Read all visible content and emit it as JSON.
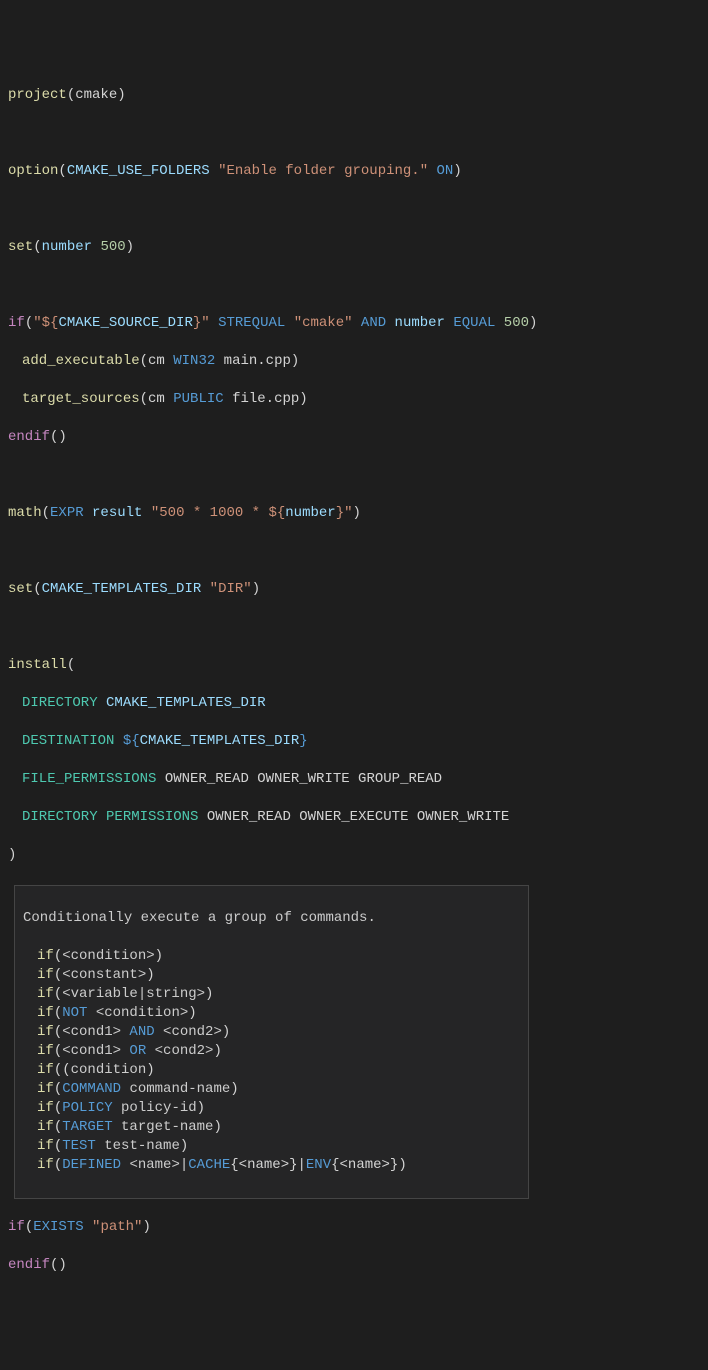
{
  "code": {
    "l1": {
      "fn": "project",
      "arg": "cmake"
    },
    "l2": {
      "fn": "option",
      "var": "CMAKE_USE_FOLDERS",
      "str": "\"Enable folder grouping.\"",
      "val": "ON"
    },
    "l3": {
      "fn": "set",
      "var": "number",
      "num": "500"
    },
    "l4": {
      "kw": "if",
      "str1": "\"${",
      "var1": "CMAKE_SOURCE_DIR",
      "str1b": "}\"",
      "op1": "STREQUAL",
      "str2": "\"cmake\"",
      "and": "AND",
      "var2": "number",
      "op2": "EQUAL",
      "num": "500"
    },
    "l5": {
      "fn": "add_executable",
      "args1": "cm",
      "kw": "WIN32",
      "args2": "main.cpp"
    },
    "l6": {
      "fn": "target_sources",
      "args1": "cm",
      "kw": "PUBLIC",
      "args2": "file.cpp"
    },
    "l7": {
      "kw": "endif"
    },
    "l8": {
      "fn": "math",
      "kw": "EXPR",
      "var": "result",
      "str": "\"500 * 1000 * ${",
      "innerVar": "number",
      "strEnd": "}\""
    },
    "l9": {
      "fn": "set",
      "var": "CMAKE_TEMPLATES_DIR",
      "str": "\"DIR\""
    },
    "l10": {
      "fn": "install"
    },
    "l11": {
      "kw": "DIRECTORY",
      "var": "CMAKE_TEMPLATES_DIR"
    },
    "l12": {
      "kw": "DESTINATION",
      "pre": "${",
      "var": "CMAKE_TEMPLATES_DIR",
      "post": "}"
    },
    "l13": {
      "kw": "FILE_PERMISSIONS",
      "vals": "OWNER_READ OWNER_WRITE GROUP_READ"
    },
    "l14": {
      "kw": "DIRECTORY PERMISSIONS",
      "vals": "OWNER_READ OWNER_EXECUTE OWNER_WRITE"
    },
    "l15": {
      "close": ")"
    },
    "l16": {
      "kw": "if",
      "fn": "EXISTS",
      "str": "\"path\""
    },
    "l17": {
      "kw": "endif"
    }
  },
  "tooltip": {
    "title": "Conditionally execute a group of commands.",
    "rows": [
      {
        "pre": "if",
        "open": "(",
        "a": "<condition>",
        "close": ")"
      },
      {
        "pre": "if",
        "open": "(",
        "a": "<constant>",
        "close": ")"
      },
      {
        "pre": "if",
        "open": "(",
        "a": "<variable|string>",
        "close": ")"
      },
      {
        "pre": "if",
        "open": "(",
        "kw": "NOT ",
        "a": "<condition>",
        "close": ")"
      },
      {
        "pre": "if",
        "open": "(",
        "a": "<cond1>",
        "kw": " AND ",
        "b": "<cond2>",
        "close": ")"
      },
      {
        "pre": "if",
        "open": "(",
        "a": "<cond1>",
        "kw": " OR ",
        "b": "<cond2>",
        "close": ")"
      },
      {
        "pre": "if",
        "open": "((",
        "a": "condition",
        "close": ")"
      },
      {
        "pre": "if",
        "open": "(",
        "kw": "COMMAND ",
        "a": "command-name",
        "close": ")"
      },
      {
        "pre": "if",
        "open": "(",
        "kw": "POLICY ",
        "a": "policy-id",
        "close": ")"
      },
      {
        "pre": "if",
        "open": "(",
        "kw": "TARGET ",
        "a": "target-name",
        "close": ")"
      },
      {
        "pre": "if",
        "open": "(",
        "kw": "TEST ",
        "a": "test-name",
        "close": ")"
      },
      {
        "pre": "if",
        "open": "(",
        "kw": "DEFINED ",
        "a": "<name>",
        "sep1": "|",
        "kw2": "CACHE",
        "brace": "{<name>}",
        "sep2": "|",
        "kw3": "ENV",
        "brace2": "{<name>}",
        "close": ")"
      }
    ]
  }
}
